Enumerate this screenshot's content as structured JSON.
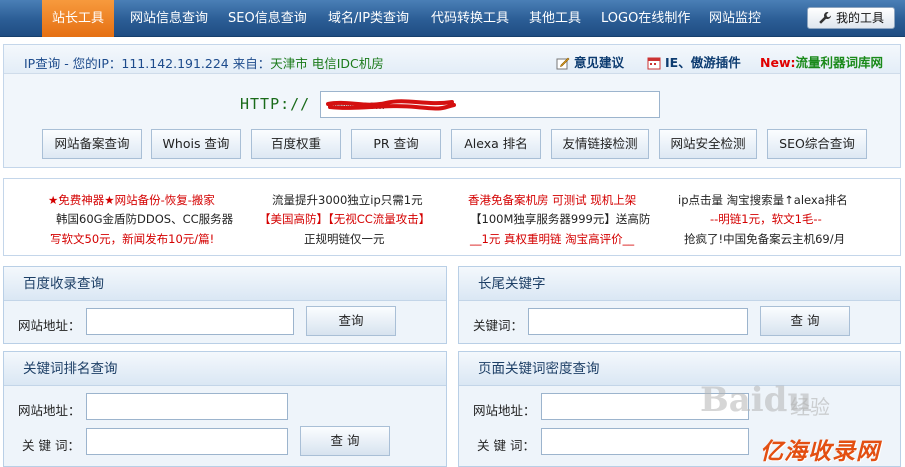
{
  "nav": {
    "items": [
      "站长工具",
      "网站信息查询",
      "SEO信息查询",
      "域名/IP类查询",
      "代码转换工具",
      "其他工具",
      "LOGO在线制作",
      "网站监控"
    ],
    "my_tools": "我的工具"
  },
  "ip_bar": {
    "prefix": "IP查询 - 您的IP：",
    "ip": "111.142.191.224",
    "from": " 来自：",
    "location": "天津市 电信IDC机房",
    "feedback": "意见建议",
    "plugin": "IE、傲游插件",
    "new_label": "New:",
    "new_text": "流量利器词库网"
  },
  "query": {
    "http_label": "HTTP://",
    "url_value": "www.seo...",
    "buttons": [
      "网站备案查询",
      "Whois 查询",
      "百度权重",
      "PR 查询",
      "Alexa 排名",
      "友情链接检测",
      "网站安全检测",
      "SEO综合查询"
    ]
  },
  "ads": [
    [
      "★免费神器★网站备份-恢复-搬家",
      "韩国60G金盾防DDOS、CC服务器",
      "写软文50元，新闻发布10元/篇!"
    ],
    [
      "流量提升3000独立ip只需1元",
      "【美国高防】【无视CC流量攻击】",
      "正规明链仅一元"
    ],
    [
      "香港免备案机房 可测试 现机上架",
      "【100M独享服务器999元】送高防",
      "__1元 真权重明链 淘宝高评价__"
    ],
    [
      "ip点击量 淘宝搜索量↑alexa排名",
      "--明链1元，软文1毛--",
      "抢疯了!中国免备案云主机69/月"
    ]
  ],
  "boxes": {
    "baidu": {
      "title": "百度收录查询",
      "label": "网站地址：",
      "button": "查询"
    },
    "longtail": {
      "title": "长尾关键字",
      "label": "关键词：",
      "button": "查 询"
    },
    "rank": {
      "title": "关键词排名查询",
      "label_site": "网站地址：",
      "label_kw": "关 键 词：",
      "button": "查 询"
    },
    "density": {
      "title": "页面关键词密度查询",
      "label_site": "网站地址：",
      "label_kw": "关 键 词："
    }
  },
  "watermark": {
    "brand": "Baidu",
    "cn": "经验",
    "sub": "jingyan"
  },
  "logo_text": "亿海收录网"
}
